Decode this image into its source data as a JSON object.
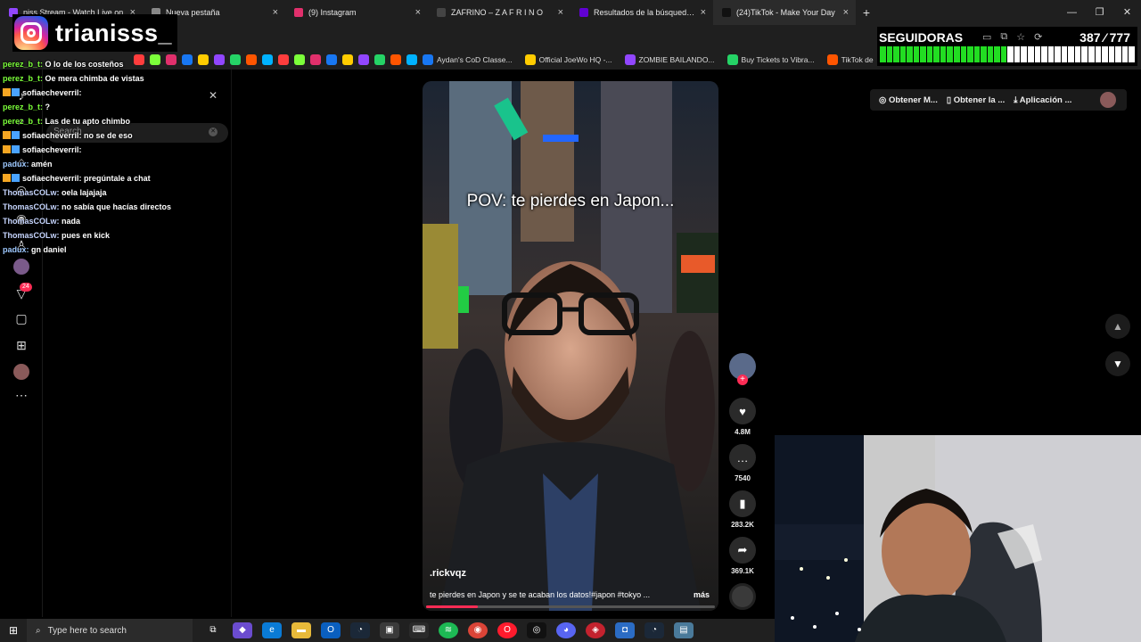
{
  "browser": {
    "tabs": [
      {
        "title": "niss Stream - Watch Live on",
        "color": "#9146ff"
      },
      {
        "title": "Nueva pestaña",
        "color": "#888888"
      },
      {
        "title": "(9) Instagram",
        "color": "#e1306c"
      },
      {
        "title": "ZAFRINO – Z A F R I N O",
        "color": "#444444"
      },
      {
        "title": "Resultados de la búsqueda de",
        "color": "#6001d2"
      },
      {
        "title": "(24)TikTok - Make Your Day",
        "color": "#111111"
      }
    ],
    "new_tab": "+",
    "window_controls": [
      "—",
      "❐",
      "✕"
    ],
    "bookmarks": [
      "Aydan's CoD Classe...",
      "Official JoeWo HQ -...",
      "ZOMBIE BAILANDO...",
      "Buy Tickets to Vibra...",
      "TikTok de"
    ]
  },
  "overlay": {
    "instagram_handle": "trianisss_",
    "followers_label": "SEGUIDORAS",
    "followers_count": "387 ⁄ 777",
    "followers_progress": 0.5
  },
  "chat": [
    {
      "user": "perez_b_t",
      "text": "O lo de los costeños",
      "color": "green",
      "badge": false
    },
    {
      "user": "perez_b_t",
      "text": "Oe mera chimba de vistas",
      "color": "green",
      "badge": false
    },
    {
      "user": "sofiaecheverril",
      "text": "",
      "color": "white",
      "badge": true
    },
    {
      "user": "perez_b_t",
      "text": "?",
      "color": "green",
      "badge": false
    },
    {
      "user": "perez_b_t",
      "text": "Las de tu apto chimbo",
      "color": "green",
      "badge": false
    },
    {
      "user": "sofiaecheverril",
      "text": "no se de eso",
      "color": "white",
      "badge": true
    },
    {
      "user": "sofiaecheverril",
      "text": "",
      "color": "white",
      "badge": true
    },
    {
      "user": "padux",
      "text": "amén",
      "color": "blue",
      "badge": false
    },
    {
      "user": "sofiaecheverril",
      "text": "pregúntale a chat",
      "color": "white",
      "badge": true
    },
    {
      "user": "ThomasCOLw",
      "text": "oela lajajaja",
      "color": "pale",
      "badge": false
    },
    {
      "user": "ThomasCOLw",
      "text": "no sabía que hacías directos",
      "color": "pale",
      "badge": false
    },
    {
      "user": "ThomasCOLw",
      "text": "nada",
      "color": "pale",
      "badge": false
    },
    {
      "user": "ThomasCOLw",
      "text": "pues en kick",
      "color": "pale",
      "badge": false
    },
    {
      "user": "padux",
      "text": "gn daniel",
      "color": "blue",
      "badge": false
    }
  ],
  "tiktok": {
    "search_placeholder": "Search",
    "notification_count": "24",
    "top_actions": [
      "Obtener M...",
      "Obtener la ...",
      "Aplicación ..."
    ],
    "video": {
      "caption": "POV: te pierdes en Japon...",
      "author": ".rickvqz",
      "description": "te pierdes en Japon y se te acaban los datos!#japon #tokyo ...",
      "more": "más",
      "progress": 0.18
    },
    "actions": {
      "likes": "4.8M",
      "comments": "7540",
      "saves": "283.2K",
      "shares": "369.1K"
    }
  },
  "taskbar": {
    "search_placeholder": "Type here to search"
  }
}
